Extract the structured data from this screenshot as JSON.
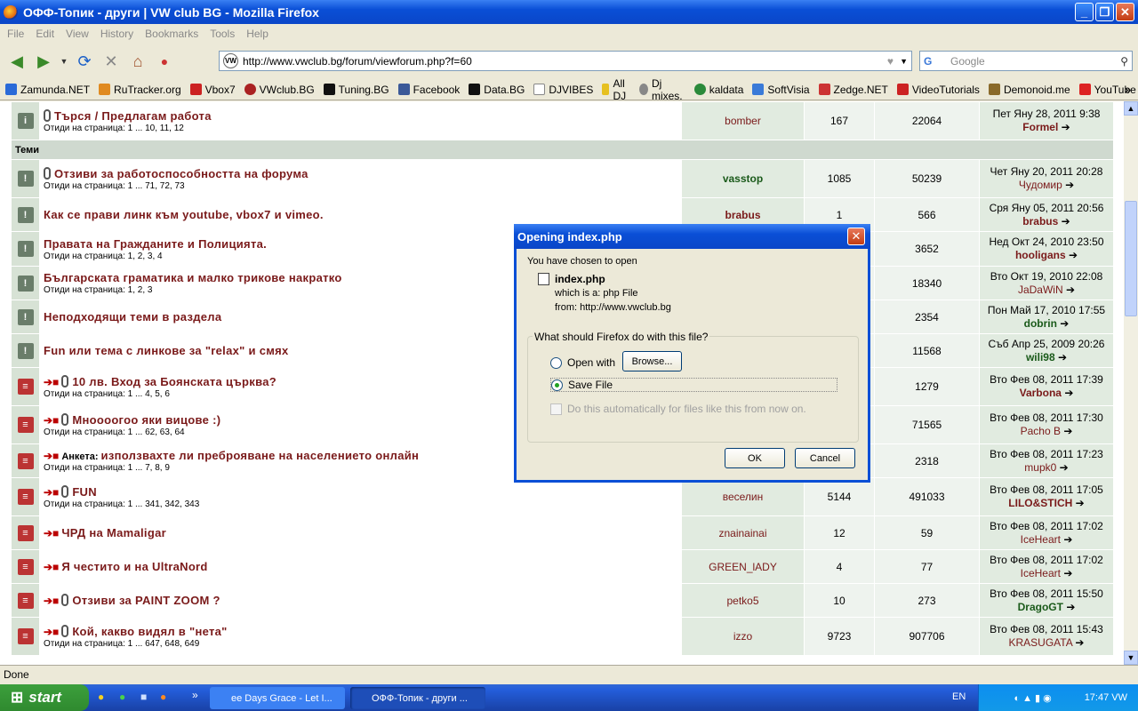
{
  "window": {
    "title": "ОФФ-Топик - други | VW club BG - Mozilla Firefox"
  },
  "menu": [
    "File",
    "Edit",
    "View",
    "History",
    "Bookmarks",
    "Tools",
    "Help"
  ],
  "address": {
    "url": "http://www.vwclub.bg/forum/viewforum.php?f=60"
  },
  "search": {
    "placeholder": "Google"
  },
  "bookmarks": [
    "Zamunda.NET",
    "RuTracker.org",
    "Vbox7",
    "VWclub.BG",
    "Tuning.BG",
    "Facebook",
    "Data.BG",
    "DJVIBES",
    "All DJ",
    "Dj mixes.",
    "kaldata",
    "SoftVisia",
    "Zedge.NET",
    "VideoTutorials",
    "Demonoid.me",
    "YouTube"
  ],
  "forum": {
    "top_row": {
      "title": "Търся / Предлагам работа",
      "pages": "Отиди на страница: 1 ... 10, 11, 12",
      "author": "bomber",
      "replies": "167",
      "views": "22064",
      "last_date": "Пет Яну 28, 2011 9:38",
      "last_user": "Formel"
    },
    "category": "Теми",
    "rows": [
      {
        "title": "Отзиви за работоспособността на форума",
        "pages": "Отиди на страница: 1 ... 71, 72, 73",
        "author": "vasstop",
        "replies": "1085",
        "views": "50239",
        "last_date": "Чет Яну 20, 2011 20:28",
        "last_user": "Чудомир"
      },
      {
        "title": "Как се прави линк към youtube, vbox7 и vimeo.",
        "pages": "",
        "author": "brabus",
        "replies": "1",
        "views": "566",
        "last_date": "Сря Яну 05, 2011 20:56",
        "last_user": "brabus"
      },
      {
        "title": "Правата на Гражданите и Полицията.",
        "pages": "Отиди на страница: 1, 2, 3, 4",
        "author": "",
        "replies": "",
        "views": "3652",
        "last_date": "Нед Окт 24, 2010 23:50",
        "last_user": "hooligans"
      },
      {
        "title": "Българската граматика и малко трикове накратко",
        "pages": "Отиди на страница: 1, 2, 3",
        "author": "",
        "replies": "",
        "views": "18340",
        "last_date": "Вто Окт 19, 2010 22:08",
        "last_user": "JaDaWiN"
      },
      {
        "title": "Неподходящи теми в раздела",
        "pages": "",
        "author": "",
        "replies": "",
        "views": "2354",
        "last_date": "Пон Май 17, 2010 17:55",
        "last_user": "dobrin"
      },
      {
        "title": "Fun или тема с линкове за \"relax\" и смях",
        "pages": "",
        "author": "",
        "replies": "",
        "views": "11568",
        "last_date": "Съб Апр 25, 2009 20:26",
        "last_user": "wili98"
      },
      {
        "title": "10 лв. Вход за Боянската църква?",
        "pages": "Отиди на страница: 1 ... 4, 5, 6",
        "author": "",
        "replies": "",
        "views": "1279",
        "last_date": "Вто Фев 08, 2011 17:39",
        "last_user": "Varbona"
      },
      {
        "title": "Мноооогоо яки вицове :)",
        "pages": "Отиди на страница: 1 ... 62, 63, 64",
        "author": "",
        "replies": "",
        "views": "71565",
        "last_date": "Вто Фев 08, 2011 17:30",
        "last_user": "Pacho B"
      },
      {
        "title": "използвахте ли преброяване на населението онлайн",
        "prefix": "Анкета:",
        "pages": "Отиди на страница: 1 ... 7, 8, 9",
        "author": "",
        "replies": "",
        "views": "2318",
        "last_date": "Вто Фев 08, 2011 17:23",
        "last_user": "mupk0"
      },
      {
        "title": "FUN",
        "pages": "Отиди на страница: 1 ... 341, 342, 343",
        "author": "веселин",
        "replies": "5144",
        "views": "491033",
        "last_date": "Вто Фев 08, 2011 17:05",
        "last_user": "LILO&STICH"
      },
      {
        "title": "ЧРД на Mamaligar",
        "pages": "",
        "author": "znainainai",
        "replies": "12",
        "views": "59",
        "last_date": "Вто Фев 08, 2011 17:02",
        "last_user": "IceHeart"
      },
      {
        "title": "Я честито и на UltraNord",
        "pages": "",
        "author": "GREEN_lADY",
        "replies": "4",
        "views": "77",
        "last_date": "Вто Фев 08, 2011 17:02",
        "last_user": "IceHeart"
      },
      {
        "title": "Отзиви за PAINT ZOOM ?",
        "pages": "",
        "author": "petko5",
        "replies": "10",
        "views": "273",
        "last_date": "Вто Фев 08, 2011 15:50",
        "last_user": "DragoGT"
      },
      {
        "title": "Кой, какво видял в \"нета\"",
        "pages": "Отиди на страница: 1 ... 647, 648, 649",
        "author": "izzo",
        "replies": "9723",
        "views": "907706",
        "last_date": "Вто Фев 08, 2011 15:43",
        "last_user": "KRASUGATA"
      }
    ]
  },
  "status": "Done",
  "taskbar": {
    "start": "start",
    "task1": "ee Days Grace - Let I...",
    "task2": "ОФФ-Топик - други ...",
    "lang": "EN",
    "clock": "17:47 VW"
  },
  "dialog": {
    "title": "Opening index.php",
    "intro": "You have chosen to open",
    "filename": "index.php",
    "which_is": "which is a:  php File",
    "from": "from:  http://www.vwclub.bg",
    "question": "What should Firefox do with this file?",
    "open_with": "Open with",
    "browse": "Browse...",
    "save_file": "Save File",
    "auto": "Do this automatically for files like this from now on.",
    "ok": "OK",
    "cancel": "Cancel"
  }
}
